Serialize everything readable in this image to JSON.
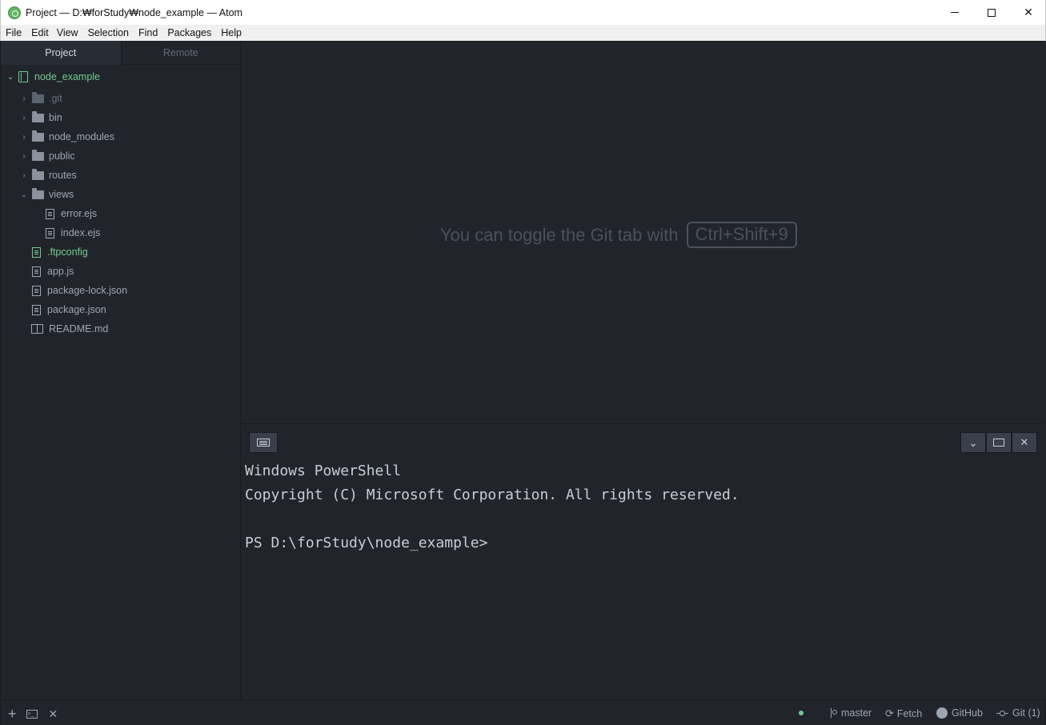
{
  "window": {
    "title": "Project — D:₩forStudy₩node_example — Atom",
    "minimize": "",
    "maximize": "",
    "close": "✕"
  },
  "menu": [
    "File",
    "Edit",
    "View",
    "Selection",
    "Find",
    "Packages",
    "Help"
  ],
  "sidebar": {
    "tabs": [
      {
        "label": "Project",
        "active": true
      },
      {
        "label": "Remote",
        "active": false
      }
    ],
    "tree": [
      {
        "label": "node_example",
        "type": "root",
        "expanded": true
      },
      {
        "label": ".git",
        "type": "folder",
        "expanded": false,
        "ignored": true
      },
      {
        "label": "bin",
        "type": "folder",
        "expanded": false
      },
      {
        "label": "node_modules",
        "type": "folder",
        "expanded": false
      },
      {
        "label": "public",
        "type": "folder",
        "expanded": false
      },
      {
        "label": "routes",
        "type": "folder",
        "expanded": false
      },
      {
        "label": "views",
        "type": "folder",
        "expanded": true
      },
      {
        "label": "error.ejs",
        "type": "file"
      },
      {
        "label": "index.ejs",
        "type": "file"
      },
      {
        "label": ".ftpconfig",
        "type": "file",
        "status": "added"
      },
      {
        "label": "app.js",
        "type": "file"
      },
      {
        "label": "package-lock.json",
        "type": "file"
      },
      {
        "label": "package.json",
        "type": "file"
      },
      {
        "label": "README.md",
        "type": "readme"
      }
    ]
  },
  "editor": {
    "hint_text": "You can toggle the Git tab with",
    "hint_shortcut": "Ctrl+Shift+9"
  },
  "terminal": {
    "lines": [
      "Windows PowerShell",
      "Copyright (C) Microsoft Corporation. All rights reserved.",
      "",
      "PS D:\\forStudy\\node_example>"
    ],
    "close_label": "✕",
    "down_label": "⌄"
  },
  "statusbar": {
    "add_label": "+",
    "term_label": ">_",
    "close_label": "✕",
    "branch": "master",
    "fetch": "Fetch",
    "github": "GitHub",
    "git": "Git (1)",
    "accent": "#73c990"
  }
}
